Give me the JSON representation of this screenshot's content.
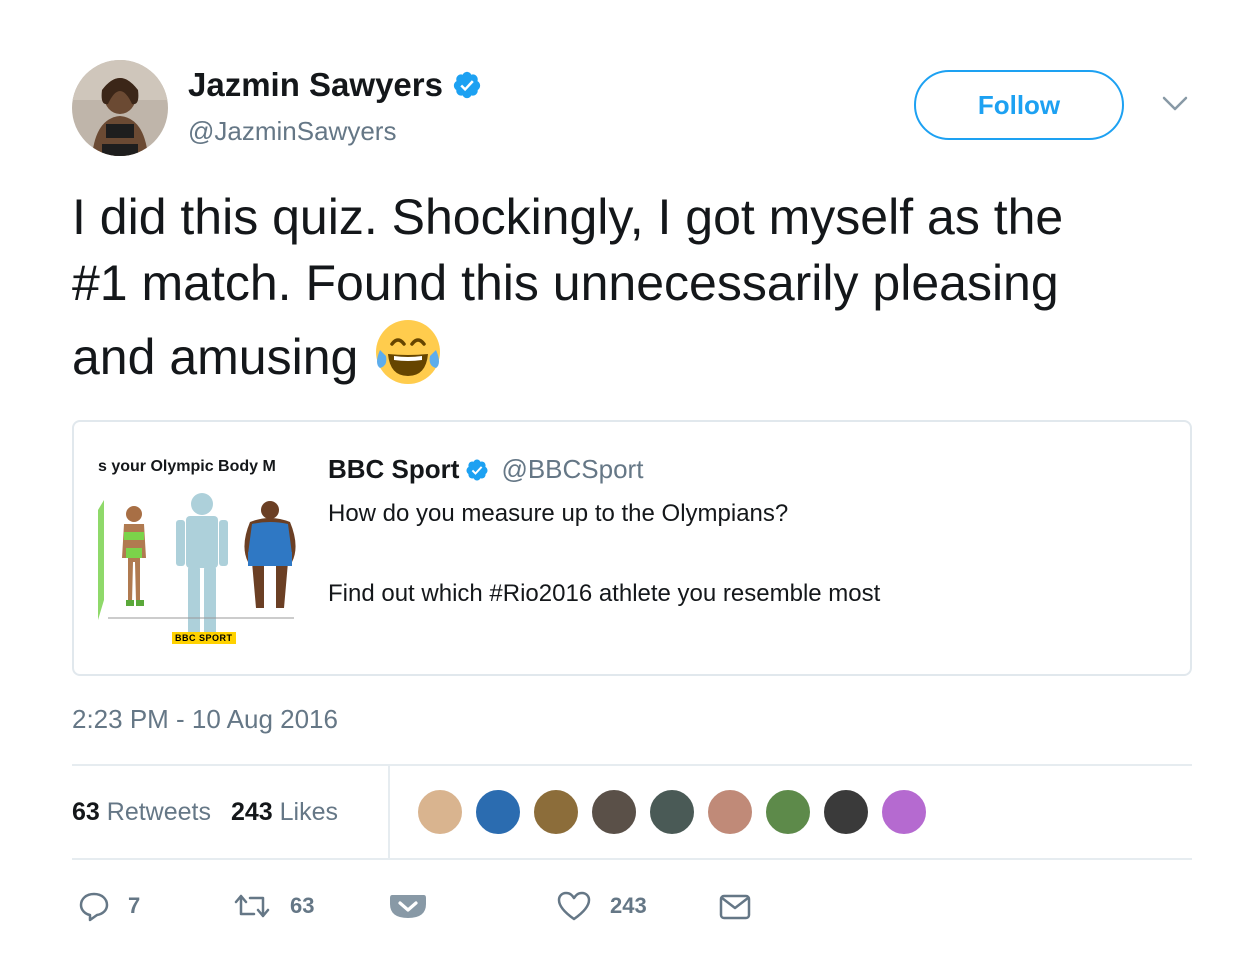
{
  "header": {
    "name": "Jazmin Sawyers",
    "handle": "@JazminSawyers",
    "follow_label": "Follow",
    "verified_icon": "verified-badge-icon",
    "caret_icon": "chevron-down-icon"
  },
  "tweet": {
    "lines": [
      "I did this quiz. Shockingly, I got myself as the",
      "#1 match. Found this unnecessarily pleasing",
      "and amusing"
    ],
    "emoji": "face-with-tears-of-joy-icon"
  },
  "quote": {
    "image_title": "s your Olympic Body M",
    "image_logo": "BBC SPORT",
    "name": "BBC Sport",
    "handle": "@BBCSport",
    "text_line1": "How do you measure up to the Olympians?",
    "text_line2": "",
    "text_line3": "Find out which #Rio2016 athlete you resemble most"
  },
  "timestamp": "2:23 PM - 10 Aug 2016",
  "stats": {
    "retweets_count": "63",
    "retweets_label": "Retweets",
    "likes_count": "243",
    "likes_label": "Likes"
  },
  "likers": [
    {
      "icon": "avatar",
      "color": "#d9b48f"
    },
    {
      "icon": "avatar",
      "color": "#2b6cb0"
    },
    {
      "icon": "avatar",
      "color": "#8c6d3a"
    },
    {
      "icon": "avatar",
      "color": "#5a5048"
    },
    {
      "icon": "avatar",
      "color": "#4a5a56"
    },
    {
      "icon": "avatar",
      "color": "#c08a78"
    },
    {
      "icon": "avatar",
      "color": "#5d8a4a"
    },
    {
      "icon": "avatar",
      "color": "#3a3a3a"
    },
    {
      "icon": "avatar",
      "color": "#b56ad0"
    }
  ],
  "actions": {
    "reply_count": "7",
    "retweet_count": "63",
    "like_count": "243"
  },
  "colors": {
    "accent": "#1da1f2",
    "muted": "#657786",
    "border": "#e1e8ed"
  }
}
